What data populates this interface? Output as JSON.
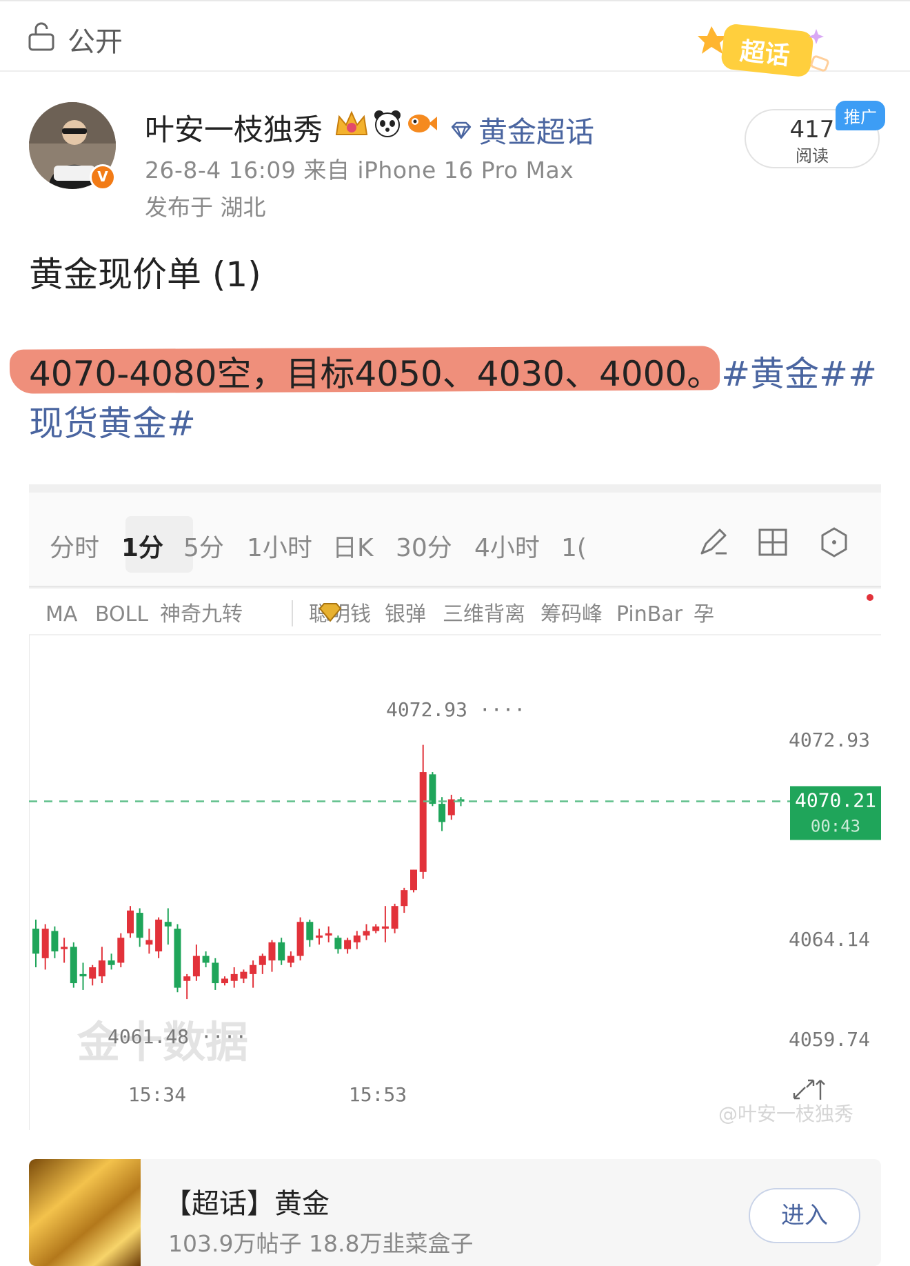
{
  "top_bar": {
    "privacy": "公开",
    "super_topic_badge": "超话"
  },
  "author": {
    "name": "叶安一枝独秀",
    "badge_icons": [
      "crown-icon",
      "panda-icon",
      "fish-icon"
    ],
    "topic_tag": "黄金超话",
    "meta": "26-8-4 16:09  来自 iPhone 16 Pro Max",
    "location": "发布于 湖北"
  },
  "stats": {
    "read_count": "417",
    "read_label": "阅读",
    "promo_label": "推广"
  },
  "post": {
    "title": "黄金现价单 (1)",
    "line1_text": "4070-4080空，目标4050、4030、4000。",
    "line1_tags": "#黄金##",
    "line2": "现货黄金#"
  },
  "chart_screenshot": {
    "timeframe_tabs": [
      "分时",
      "1分",
      "5分",
      "1小时",
      "日K",
      "30分",
      "4小时",
      "1("
    ],
    "active_tab": "1分",
    "indicators": [
      "MA",
      "BOLL",
      "神奇九转",
      "聪明钱",
      "银弹",
      "三维背离",
      "筹码峰",
      "PinBar",
      "孕"
    ],
    "price_ticks": [
      "4072.93",
      "4064.14",
      "4059.74"
    ],
    "current_price": "4070.21",
    "countdown": "00:43",
    "high_marker": "4072.93",
    "low_marker": "4061.48",
    "watermark": "金十数据",
    "credit": "@叶安一枝独秀"
  },
  "chart_data": {
    "type": "candlestick",
    "x_labels": [
      "15:34",
      "15:53"
    ],
    "ylim": [
      4059.74,
      4072.93
    ],
    "current_price": 4070.21,
    "period_high": 4072.93,
    "period_low": 4061.48,
    "candles": [
      {
        "o": 4064.6,
        "h": 4065.0,
        "c": 4063.5,
        "l": 4062.9
      },
      {
        "o": 4063.3,
        "h": 4064.8,
        "c": 4064.6,
        "l": 4062.8
      },
      {
        "o": 4064.5,
        "h": 4064.7,
        "c": 4063.6,
        "l": 4063.3
      },
      {
        "o": 4063.7,
        "h": 4064.2,
        "c": 4063.8,
        "l": 4063.1
      },
      {
        "o": 4063.8,
        "h": 4064.0,
        "c": 4062.2,
        "l": 4062.0
      },
      {
        "o": 4062.6,
        "h": 4063.1,
        "c": 4062.5,
        "l": 4061.9
      },
      {
        "o": 4062.4,
        "h": 4063.0,
        "c": 4062.9,
        "l": 4062.1
      },
      {
        "o": 4062.5,
        "h": 4063.8,
        "c": 4063.2,
        "l": 4062.2
      },
      {
        "o": 4063.2,
        "h": 4063.5,
        "c": 4063.0,
        "l": 4062.8
      },
      {
        "o": 4063.1,
        "h": 4064.4,
        "c": 4064.2,
        "l": 4062.9
      },
      {
        "o": 4064.4,
        "h": 4065.6,
        "c": 4065.4,
        "l": 4064.2
      },
      {
        "o": 4065.3,
        "h": 4065.5,
        "c": 4064.2,
        "l": 4063.8
      },
      {
        "o": 4063.9,
        "h": 4064.6,
        "c": 4064.1,
        "l": 4063.5
      },
      {
        "o": 4063.6,
        "h": 4065.1,
        "c": 4065.0,
        "l": 4063.3
      },
      {
        "o": 4064.9,
        "h": 4065.5,
        "c": 4064.7,
        "l": 4063.9
      },
      {
        "o": 4064.6,
        "h": 4064.8,
        "c": 4062.0,
        "l": 4061.8
      },
      {
        "o": 4062.3,
        "h": 4062.6,
        "c": 4062.5,
        "l": 4061.5
      },
      {
        "o": 4062.5,
        "h": 4063.9,
        "c": 4063.4,
        "l": 4062.3
      },
      {
        "o": 4063.4,
        "h": 4063.6,
        "c": 4063.1,
        "l": 4062.9
      },
      {
        "o": 4063.1,
        "h": 4063.3,
        "c": 4062.2,
        "l": 4061.9
      },
      {
        "o": 4062.2,
        "h": 4062.5,
        "c": 4062.4,
        "l": 4062.1
      },
      {
        "o": 4062.3,
        "h": 4062.9,
        "c": 4062.6,
        "l": 4062.0
      },
      {
        "o": 4062.4,
        "h": 4062.8,
        "c": 4062.7,
        "l": 4062.2
      },
      {
        "o": 4062.6,
        "h": 4063.2,
        "c": 4063.0,
        "l": 4062.0
      },
      {
        "o": 4063.0,
        "h": 4063.5,
        "c": 4063.4,
        "l": 4062.6
      },
      {
        "o": 4063.2,
        "h": 4064.1,
        "c": 4064.0,
        "l": 4062.7
      },
      {
        "o": 4064.0,
        "h": 4064.2,
        "c": 4063.2,
        "l": 4063.0
      },
      {
        "o": 4063.1,
        "h": 4063.6,
        "c": 4063.4,
        "l": 4062.9
      },
      {
        "o": 4063.4,
        "h": 4065.1,
        "c": 4064.9,
        "l": 4063.2
      },
      {
        "o": 4064.9,
        "h": 4065.0,
        "c": 4064.1,
        "l": 4063.8
      },
      {
        "o": 4064.2,
        "h": 4064.6,
        "c": 4064.3,
        "l": 4063.9
      },
      {
        "o": 4064.3,
        "h": 4064.7,
        "c": 4064.4,
        "l": 4064.0
      },
      {
        "o": 4064.2,
        "h": 4064.3,
        "c": 4063.7,
        "l": 4063.5
      },
      {
        "o": 4063.7,
        "h": 4064.2,
        "c": 4064.1,
        "l": 4063.5
      },
      {
        "o": 4064.0,
        "h": 4064.5,
        "c": 4064.3,
        "l": 4063.7
      },
      {
        "o": 4064.3,
        "h": 4064.8,
        "c": 4064.5,
        "l": 4064.1
      },
      {
        "o": 4064.5,
        "h": 4064.8,
        "c": 4064.7,
        "l": 4064.4
      },
      {
        "o": 4064.6,
        "h": 4065.6,
        "c": 4064.7,
        "l": 4064.0
      },
      {
        "o": 4064.6,
        "h": 4065.7,
        "c": 4065.6,
        "l": 4064.4
      },
      {
        "o": 4065.6,
        "h": 4066.4,
        "c": 4066.3,
        "l": 4065.3
      },
      {
        "o": 4066.3,
        "h": 4067.2,
        "c": 4067.2,
        "l": 4066.2
      },
      {
        "o": 4067.1,
        "h": 4072.7,
        "c": 4071.5,
        "l": 4066.8
      },
      {
        "o": 4071.4,
        "h": 4071.5,
        "c": 4070.1,
        "l": 4070.0
      },
      {
        "o": 4070.1,
        "h": 4070.4,
        "c": 4069.3,
        "l": 4068.9
      },
      {
        "o": 4069.6,
        "h": 4070.5,
        "c": 4070.3,
        "l": 4069.4
      },
      {
        "o": 4070.3,
        "h": 4070.4,
        "c": 4070.2,
        "l": 4070.0
      }
    ]
  },
  "card": {
    "title": "【超话】黄金",
    "subtitle": "103.9万帖子 18.8万韭菜盒子",
    "enter_label": "进入"
  },
  "colors": {
    "link": "#4a65a0",
    "highlight": "#ee8670",
    "candle_up": "#e2323a",
    "candle_down": "#1fa55a",
    "price_tag": "#1fa55a"
  }
}
